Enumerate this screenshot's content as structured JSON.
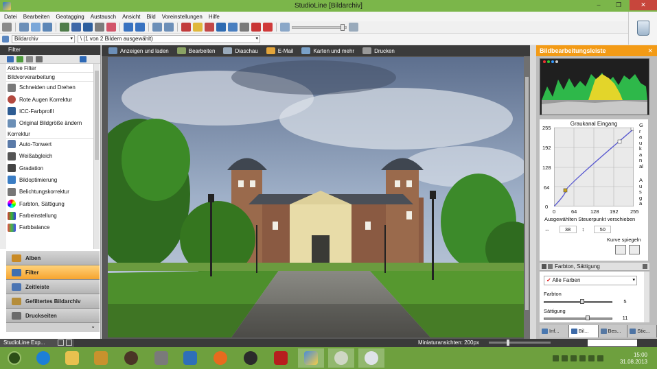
{
  "window": {
    "title": "StudioLine [Bildarchiv]",
    "minimize": "‒",
    "restore": "❐",
    "close": "✕"
  },
  "menu": [
    "Datei",
    "Bearbeiten",
    "Geotagging",
    "Austausch",
    "Ansicht",
    "Bild",
    "Voreinstellungen",
    "Hilfe"
  ],
  "path": {
    "archive": "Bildarchiv",
    "selection": "\\ (1 von 2 Bildern ausgewählt)"
  },
  "left_panel": {
    "title": "Filter",
    "active_filter": "Aktive Filter",
    "sections": [
      {
        "label": "Bildvorverarbeitung",
        "items": [
          "Schneiden und Drehen",
          "Rote Augen Korrektur",
          "ICC-Farbprofil",
          "Original Bildgröße ändern"
        ]
      },
      {
        "label": "Korrektur",
        "items": [
          "Auto-Tonwert",
          "Weißabgleich",
          "Gradation",
          "Bildoptimierung",
          "Belichtungskorrektur",
          "Farbton, Sättigung",
          "Farbeinstellung",
          "Farbbalance"
        ]
      }
    ],
    "nav": [
      "Alben",
      "Filter",
      "Zeitleiste",
      "Gefiltertes Bildarchiv",
      "Druckseiten"
    ],
    "nav_active": "Filter",
    "chevron": "⌄"
  },
  "actions": [
    "Anzeigen und laden",
    "Bearbeiten",
    "Diaschau",
    "E-Mail",
    "Karten und mehr",
    "Drucken"
  ],
  "right_panel": {
    "title": "Bildbearbeitungsleiste",
    "close": "✕",
    "curve": {
      "title": "Graukanal Eingang",
      "y_ticks": [
        "255",
        "192",
        "128",
        "64",
        "0"
      ],
      "x_ticks": [
        "0",
        "64",
        "128",
        "192",
        "255"
      ],
      "side_label_top": "Graukanal",
      "side_label_bottom": "Ausga",
      "instruction": "Ausgewählten Steuerpunkt verschieben",
      "input_value": "38",
      "output_value": "50",
      "mirror_label": "Kurve spiegeln"
    },
    "hue_sat": {
      "title": "Farbton, Sättigung",
      "colors_select": "Alle Farben",
      "hue_label": "Farbton",
      "hue_value": "5",
      "sat_label": "Sättigung",
      "sat_value": "11"
    },
    "tabs": [
      "Inf...",
      "Bil...",
      "Bes...",
      "Stic..."
    ],
    "active_tab": "Bil..."
  },
  "status": {
    "explorer": "StudioLine Exp...",
    "thumbnail_size": "Miniaturansichten: 200px"
  },
  "taskbar": {
    "time": "15:00",
    "date": "31.08.2013"
  }
}
